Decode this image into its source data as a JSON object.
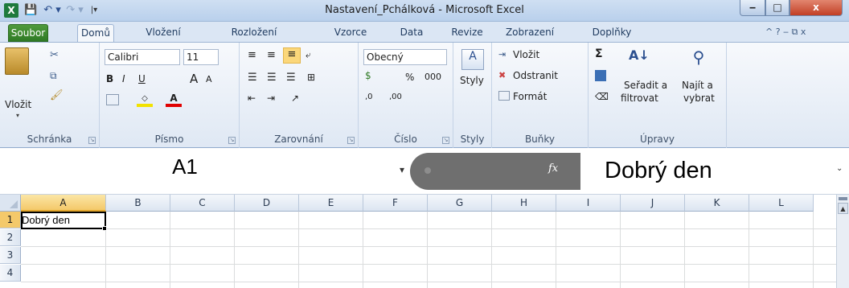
{
  "window": {
    "title": "Nastavení_Pchálková  -  Microsoft Excel",
    "app_icon": "X",
    "buttons": {
      "minimize": "‒",
      "maximize": "□",
      "close": "x"
    }
  },
  "quick_access": {
    "save": "💾",
    "undo": "↶ ▾",
    "redo": "↷ ▾",
    "customize": "|▾"
  },
  "tabs": {
    "file": "Soubor",
    "home": "Domů",
    "insert": "Vložení",
    "layout": "Rozložení stránky",
    "formulas": "Vzorce",
    "data": "Data",
    "review": "Revize",
    "view": "Zobrazení",
    "addins": "Doplňky",
    "right_controls": "^  ?  ‒  ⧉  x"
  },
  "ribbon": {
    "clipboard": {
      "label": "Schránka",
      "paste": "Vložit",
      "paste_arrow": "▾"
    },
    "font": {
      "label": "Písmo",
      "font_name": "Calibri",
      "font_size": "11",
      "bold": "B",
      "italic": "I",
      "underline": "U",
      "grow": "A",
      "shrink": "A"
    },
    "alignment": {
      "label": "Zarovnání"
    },
    "number": {
      "label": "Číslo",
      "format": "Obecný",
      "percent": "%",
      "thousands": "000",
      "inc_dec": ",0",
      "dec_dec": ",00"
    },
    "styles": {
      "label": "Styly",
      "button": "Styly"
    },
    "cells": {
      "label": "Buňky",
      "insert": "Vložit",
      "delete": "Odstranit",
      "format": "Formát"
    },
    "editing": {
      "label": "Úpravy",
      "sort": "Seřadit a",
      "sort2": "filtrovat",
      "find": "Najít a",
      "find2": "vybrat",
      "sigma": "Σ"
    }
  },
  "formula_bar": {
    "name_box": "A1",
    "fx": "fx",
    "content": "Dobrý den"
  },
  "grid": {
    "columns": [
      "A",
      "B",
      "C",
      "D",
      "E",
      "F",
      "G",
      "H",
      "I",
      "J",
      "K",
      "L"
    ],
    "rows": [
      "1",
      "2",
      "3",
      "4"
    ],
    "selected_column": "A",
    "selected_row": "1",
    "cells": {
      "A1": "Dobrý den"
    }
  },
  "colors": {
    "file_tab": "#2f7a25",
    "selection_header": "#f4c96a",
    "formula_overlay": "#6f6f6f"
  }
}
